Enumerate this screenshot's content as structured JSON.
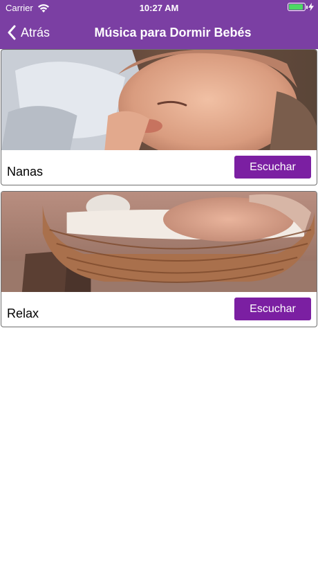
{
  "status_bar": {
    "carrier": "Carrier",
    "time": "10:27 AM",
    "battery_level": 0.9
  },
  "nav": {
    "back_label": "Atrás",
    "title": "Música para Dormir Bebés"
  },
  "colors": {
    "header_bg": "#7b3fa3",
    "button_bg": "#7b1fa2",
    "battery_fill": "#4cd964"
  },
  "cards": [
    {
      "label": "Nanas",
      "button_label": "Escuchar",
      "image": "sleeping-baby-blanket-photo"
    },
    {
      "label": "Relax",
      "button_label": "Escuchar",
      "image": "baby-in-wicker-basket-photo"
    }
  ]
}
